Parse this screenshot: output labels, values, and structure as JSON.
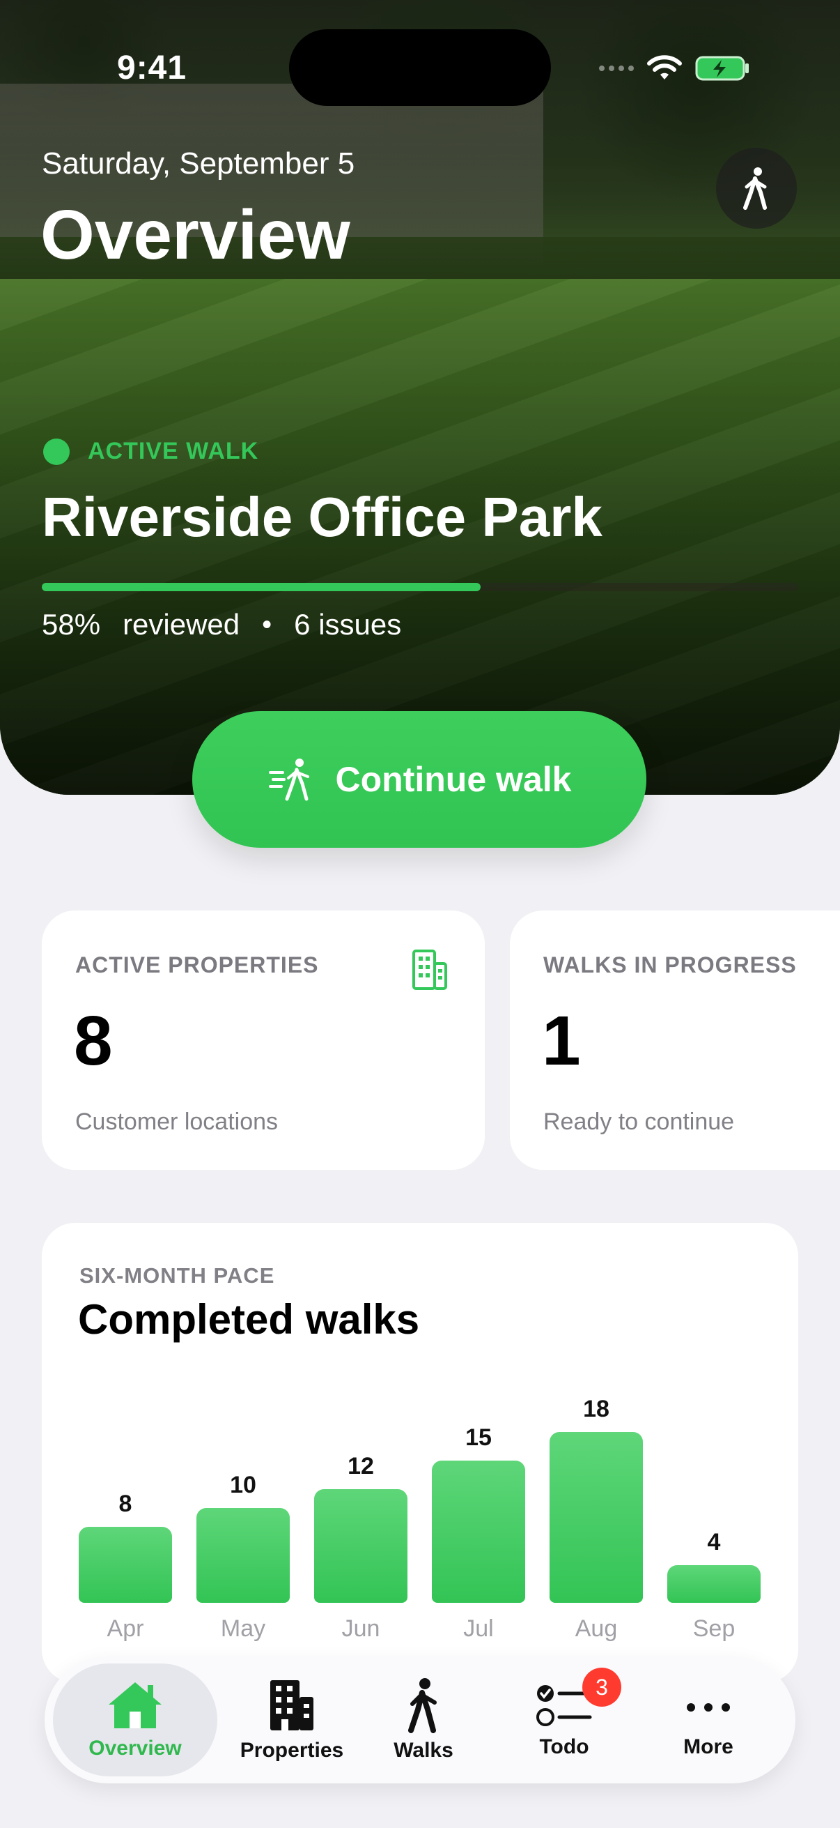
{
  "status_bar": {
    "time": "9:41"
  },
  "header": {
    "date": "Saturday, September 5",
    "title": "Overview"
  },
  "active_walk": {
    "label": "ACTIVE WALK",
    "property": "Riverside Office Park",
    "progress_fraction": 0.58,
    "percent_text": "58%",
    "reviewed_text": "reviewed",
    "separator": "•",
    "issues_text": "6 issues",
    "continue_label": "Continue walk"
  },
  "stats": [
    {
      "label": "ACTIVE PROPERTIES",
      "value": "8",
      "sub": "Customer locations",
      "icon": "building-icon"
    },
    {
      "label": "WALKS IN PROGRESS",
      "value": "1",
      "sub": "Ready to continue"
    }
  ],
  "chart_data": {
    "type": "bar",
    "eyebrow": "SIX-MONTH PACE",
    "title": "Completed walks",
    "categories": [
      "Apr",
      "May",
      "Jun",
      "Jul",
      "Aug",
      "Sep"
    ],
    "values": [
      8,
      10,
      12,
      15,
      18,
      4
    ],
    "ylim": [
      0,
      18
    ],
    "grid": false,
    "bar_color": "#34c759"
  },
  "tabbar": {
    "items": [
      {
        "label": "Overview",
        "icon": "house-icon",
        "active": true
      },
      {
        "label": "Properties",
        "icon": "building-icon"
      },
      {
        "label": "Walks",
        "icon": "walking-person-icon"
      },
      {
        "label": "Todo",
        "icon": "checklist-icon",
        "badge": "3"
      },
      {
        "label": "More",
        "icon": "ellipsis-icon"
      }
    ]
  },
  "colors": {
    "accent": "#34c759",
    "badge": "#ff3b30",
    "background": "#f1f1f5"
  }
}
